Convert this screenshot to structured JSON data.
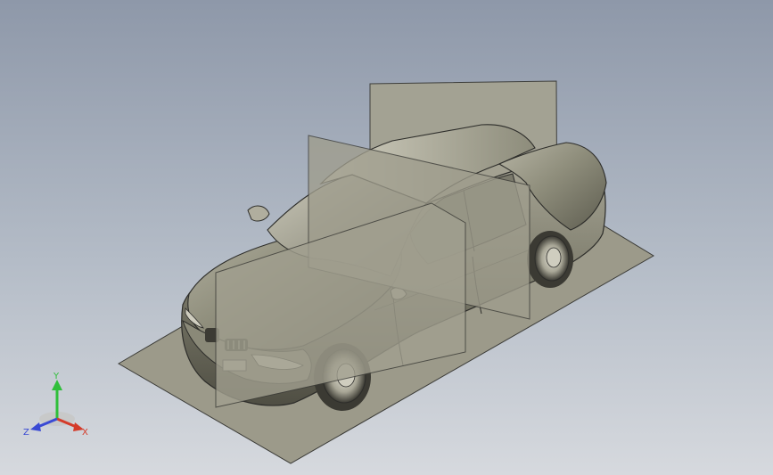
{
  "viewport": {
    "background_top": "#8e98a9",
    "background_bottom": "#d6d9de"
  },
  "model": {
    "name": "car-body-model",
    "body_color": "#8f8e7c",
    "plane_color": "#9e9c8c",
    "edge_color": "#2d2d2a"
  },
  "triad": {
    "x_label": "X",
    "y_label": "Y",
    "z_label": "Z",
    "x_color": "#d43b2a",
    "y_color": "#2fbf3a",
    "z_color": "#3a4ad4"
  }
}
